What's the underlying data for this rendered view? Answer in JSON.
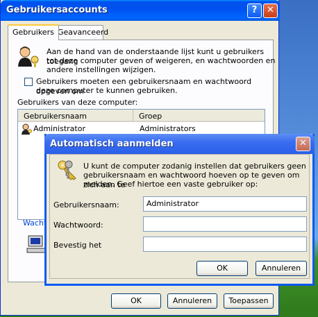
{
  "main": {
    "title": "Gebruikersaccounts",
    "tabs": [
      "Gebruikers",
      "Geavanceerd"
    ],
    "intro": "Aan de hand van de onderstaande lijst kunt u gebruikers toegang tot deze computer geven of weigeren, en wachtwoorden en andere instellingen wijzigen.",
    "intro_lines": [
      "Aan de hand van de onderstaande lijst kunt u gebruikers toegang",
      "tot deze computer geven of weigeren, en wachtwoorden en",
      "andere instellingen wijzigen."
    ],
    "checkbox_lines": [
      "Gebruikers moeten een gebruikersnaam en wachtwoord opgeven om",
      "deze computer te kunnen gebruiken."
    ],
    "list_label": "Gebruikers van deze computer:",
    "columns": [
      "Gebruikersnaam",
      "Groep"
    ],
    "rows": [
      {
        "name": "Administrator",
        "group": "Administrators"
      }
    ],
    "password_group_label": "Wacht",
    "buttons": {
      "ok": "OK",
      "cancel": "Annuleren",
      "apply": "Toepassen"
    }
  },
  "dialog": {
    "title": "Automatisch aanmelden",
    "desc_lines": [
      "U kunt de computer zodanig instellen dat gebruikers geen",
      "gebruikersnaam en wachtwoord hoeven op te geven om zich aan te",
      "melden. Geef hiertoe een vaste gebruiker op:"
    ],
    "username_label": "Gebruikersnaam:",
    "username_value": "Administrator",
    "password_label": "Wachtwoord:",
    "password_value": "",
    "confirm_label": "Bevestig het",
    "confirm_value": "",
    "buttons": {
      "ok": "OK",
      "cancel": "Annuleren"
    }
  },
  "icons": {
    "titlebar_help": "help-icon",
    "titlebar_close": "close-icon",
    "users": "users-icon",
    "user_row": "user-icon",
    "keys": "keys-icon",
    "computer": "computer-icon"
  },
  "colors": {
    "title_blue": "#0053ee",
    "dialog_title": "#3a6df0",
    "close_red": "#c43f17",
    "window_bg": "#ece9d8"
  }
}
